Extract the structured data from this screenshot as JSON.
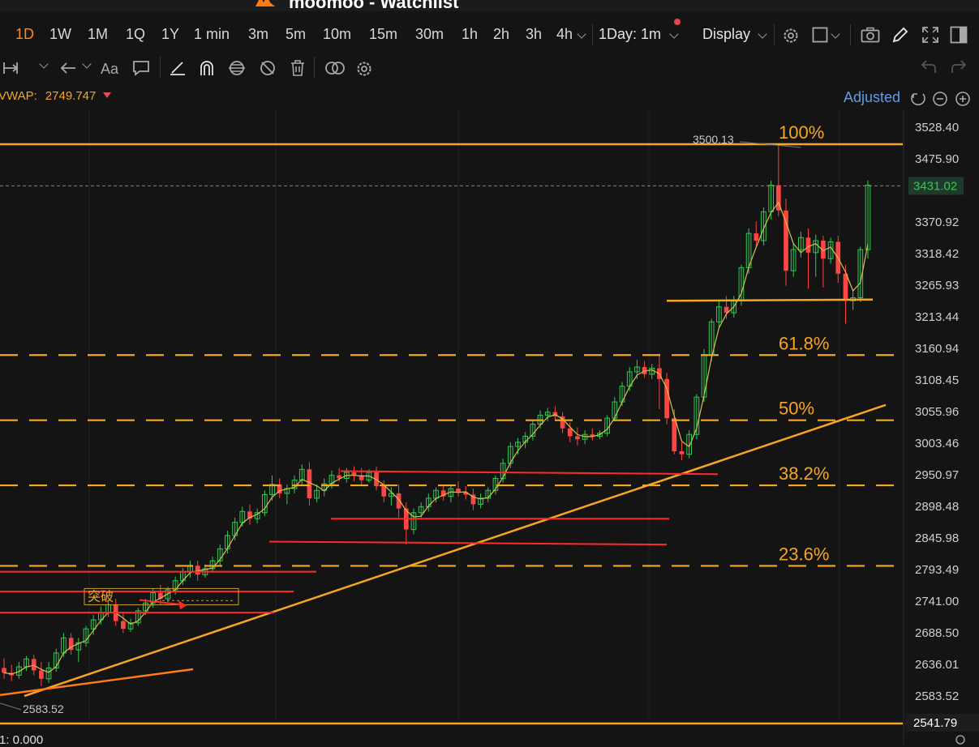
{
  "window": {
    "title": "moomoo - Watchlist"
  },
  "toolbar": {
    "timeframes": [
      "1D",
      "1W",
      "1M",
      "1Q",
      "1Y",
      "1 min",
      "3m",
      "5m",
      "10m",
      "15m",
      "30m",
      "1h",
      "2h",
      "3h",
      "4h"
    ],
    "active_timeframe": "1D",
    "interval_select": "1Day: 1m",
    "display_label": "Display"
  },
  "indicator": {
    "label": "VWAP:",
    "value": "2749.747"
  },
  "adjust_label": "Adjusted",
  "colors": {
    "up": "#2ecc52",
    "down": "#ff4444",
    "fib": "#f5a623",
    "support": "#ff2a2a",
    "background": "#141414",
    "current_price_bg": "#1f3a2a"
  },
  "chart_data": {
    "type": "candlestick",
    "ylim": [
      2541.79,
      3528.4
    ],
    "y_ticks": [
      "3528.40",
      "3475.90",
      "3431.02",
      "3370.92",
      "3318.42",
      "3265.93",
      "3213.44",
      "3160.94",
      "3108.45",
      "3055.96",
      "3003.46",
      "2950.97",
      "2898.48",
      "2845.98",
      "2793.49",
      "2741.00",
      "2688.50",
      "2636.01",
      "2583.52",
      "2541.79"
    ],
    "current_price": "3431.02",
    "high_label": "3500.13",
    "low_label": "2583.52",
    "fibonacci": [
      {
        "label": "100%",
        "value": 3500.13
      },
      {
        "label": "61.8%",
        "value": 3149.8
      },
      {
        "label": "50%",
        "value": 3041.6
      },
      {
        "label": "38.2%",
        "value": 2933.4
      },
      {
        "label": "23.6%",
        "value": 2799.6
      }
    ],
    "annotation": "突破",
    "bottom_readout": "1: 0.000",
    "candles": [
      {
        "o": 2630,
        "h": 2646,
        "l": 2612,
        "c": 2622
      },
      {
        "o": 2622,
        "h": 2635,
        "l": 2608,
        "c": 2618
      },
      {
        "o": 2618,
        "h": 2640,
        "l": 2612,
        "c": 2632
      },
      {
        "o": 2632,
        "h": 2650,
        "l": 2625,
        "c": 2645
      },
      {
        "o": 2645,
        "h": 2652,
        "l": 2618,
        "c": 2626
      },
      {
        "o": 2626,
        "h": 2640,
        "l": 2600,
        "c": 2612
      },
      {
        "o": 2612,
        "h": 2640,
        "l": 2605,
        "c": 2630
      },
      {
        "o": 2630,
        "h": 2662,
        "l": 2624,
        "c": 2655
      },
      {
        "o": 2655,
        "h": 2688,
        "l": 2648,
        "c": 2680
      },
      {
        "o": 2680,
        "h": 2688,
        "l": 2652,
        "c": 2660
      },
      {
        "o": 2660,
        "h": 2680,
        "l": 2640,
        "c": 2672
      },
      {
        "o": 2672,
        "h": 2700,
        "l": 2665,
        "c": 2695
      },
      {
        "o": 2695,
        "h": 2718,
        "l": 2685,
        "c": 2710
      },
      {
        "o": 2710,
        "h": 2732,
        "l": 2702,
        "c": 2722
      },
      {
        "o": 2722,
        "h": 2740,
        "l": 2715,
        "c": 2735
      },
      {
        "o": 2735,
        "h": 2745,
        "l": 2700,
        "c": 2708
      },
      {
        "o": 2708,
        "h": 2722,
        "l": 2688,
        "c": 2695
      },
      {
        "o": 2695,
        "h": 2712,
        "l": 2690,
        "c": 2705
      },
      {
        "o": 2705,
        "h": 2730,
        "l": 2700,
        "c": 2725
      },
      {
        "o": 2725,
        "h": 2745,
        "l": 2718,
        "c": 2738
      },
      {
        "o": 2738,
        "h": 2762,
        "l": 2730,
        "c": 2755
      },
      {
        "o": 2755,
        "h": 2768,
        "l": 2735,
        "c": 2745
      },
      {
        "o": 2745,
        "h": 2765,
        "l": 2740,
        "c": 2760
      },
      {
        "o": 2760,
        "h": 2782,
        "l": 2752,
        "c": 2775
      },
      {
        "o": 2775,
        "h": 2796,
        "l": 2768,
        "c": 2790
      },
      {
        "o": 2790,
        "h": 2808,
        "l": 2780,
        "c": 2800
      },
      {
        "o": 2800,
        "h": 2808,
        "l": 2775,
        "c": 2785
      },
      {
        "o": 2785,
        "h": 2802,
        "l": 2780,
        "c": 2795
      },
      {
        "o": 2795,
        "h": 2815,
        "l": 2790,
        "c": 2808
      },
      {
        "o": 2808,
        "h": 2835,
        "l": 2800,
        "c": 2828
      },
      {
        "o": 2828,
        "h": 2858,
        "l": 2820,
        "c": 2850
      },
      {
        "o": 2850,
        "h": 2880,
        "l": 2842,
        "c": 2872
      },
      {
        "o": 2872,
        "h": 2898,
        "l": 2865,
        "c": 2890
      },
      {
        "o": 2890,
        "h": 2902,
        "l": 2868,
        "c": 2878
      },
      {
        "o": 2878,
        "h": 2895,
        "l": 2870,
        "c": 2888
      },
      {
        "o": 2888,
        "h": 2925,
        "l": 2882,
        "c": 2918
      },
      {
        "o": 2918,
        "h": 2950,
        "l": 2908,
        "c": 2935
      },
      {
        "o": 2935,
        "h": 2945,
        "l": 2912,
        "c": 2920
      },
      {
        "o": 2920,
        "h": 2935,
        "l": 2902,
        "c": 2928
      },
      {
        "o": 2928,
        "h": 2950,
        "l": 2920,
        "c": 2942
      },
      {
        "o": 2942,
        "h": 2968,
        "l": 2935,
        "c": 2960
      },
      {
        "o": 2960,
        "h": 2972,
        "l": 2900,
        "c": 2912
      },
      {
        "o": 2912,
        "h": 2935,
        "l": 2905,
        "c": 2925
      },
      {
        "o": 2925,
        "h": 2945,
        "l": 2915,
        "c": 2936
      },
      {
        "o": 2936,
        "h": 2958,
        "l": 2928,
        "c": 2950
      },
      {
        "o": 2950,
        "h": 2962,
        "l": 2940,
        "c": 2945
      },
      {
        "o": 2945,
        "h": 2962,
        "l": 2938,
        "c": 2955
      },
      {
        "o": 2955,
        "h": 2965,
        "l": 2940,
        "c": 2950
      },
      {
        "o": 2950,
        "h": 2962,
        "l": 2935,
        "c": 2942
      },
      {
        "o": 2942,
        "h": 2960,
        "l": 2938,
        "c": 2955
      },
      {
        "o": 2955,
        "h": 2965,
        "l": 2925,
        "c": 2932
      },
      {
        "o": 2932,
        "h": 2942,
        "l": 2905,
        "c": 2915
      },
      {
        "o": 2915,
        "h": 2930,
        "l": 2900,
        "c": 2920
      },
      {
        "o": 2920,
        "h": 2935,
        "l": 2880,
        "c": 2895
      },
      {
        "o": 2895,
        "h": 2905,
        "l": 2835,
        "c": 2860
      },
      {
        "o": 2860,
        "h": 2895,
        "l": 2852,
        "c": 2888
      },
      {
        "o": 2888,
        "h": 2905,
        "l": 2880,
        "c": 2898
      },
      {
        "o": 2898,
        "h": 2920,
        "l": 2890,
        "c": 2912
      },
      {
        "o": 2912,
        "h": 2930,
        "l": 2905,
        "c": 2925
      },
      {
        "o": 2925,
        "h": 2935,
        "l": 2908,
        "c": 2915
      },
      {
        "o": 2915,
        "h": 2935,
        "l": 2905,
        "c": 2928
      },
      {
        "o": 2928,
        "h": 2940,
        "l": 2915,
        "c": 2922
      },
      {
        "o": 2922,
        "h": 2932,
        "l": 2910,
        "c": 2918
      },
      {
        "o": 2918,
        "h": 2928,
        "l": 2892,
        "c": 2902
      },
      {
        "o": 2902,
        "h": 2920,
        "l": 2895,
        "c": 2912
      },
      {
        "o": 2912,
        "h": 2930,
        "l": 2905,
        "c": 2925
      },
      {
        "o": 2925,
        "h": 2950,
        "l": 2918,
        "c": 2945
      },
      {
        "o": 2945,
        "h": 2978,
        "l": 2938,
        "c": 2970
      },
      {
        "o": 2970,
        "h": 3005,
        "l": 2962,
        "c": 2998
      },
      {
        "o": 2998,
        "h": 3012,
        "l": 2985,
        "c": 3005
      },
      {
        "o": 3005,
        "h": 3022,
        "l": 2995,
        "c": 3015
      },
      {
        "o": 3015,
        "h": 3042,
        "l": 3008,
        "c": 3035
      },
      {
        "o": 3035,
        "h": 3058,
        "l": 3028,
        "c": 3050
      },
      {
        "o": 3050,
        "h": 3062,
        "l": 3040,
        "c": 3055
      },
      {
        "o": 3055,
        "h": 3065,
        "l": 3042,
        "c": 3048
      },
      {
        "o": 3048,
        "h": 3055,
        "l": 3020,
        "c": 3028
      },
      {
        "o": 3028,
        "h": 3038,
        "l": 3005,
        "c": 3015
      },
      {
        "o": 3015,
        "h": 3030,
        "l": 3000,
        "c": 3010
      },
      {
        "o": 3010,
        "h": 3025,
        "l": 3002,
        "c": 3018
      },
      {
        "o": 3018,
        "h": 3028,
        "l": 3008,
        "c": 3015
      },
      {
        "o": 3015,
        "h": 3025,
        "l": 3010,
        "c": 3020
      },
      {
        "o": 3020,
        "h": 3050,
        "l": 3015,
        "c": 3045
      },
      {
        "o": 3045,
        "h": 3080,
        "l": 3040,
        "c": 3072
      },
      {
        "o": 3072,
        "h": 3105,
        "l": 3065,
        "c": 3098
      },
      {
        "o": 3098,
        "h": 3130,
        "l": 3090,
        "c": 3122
      },
      {
        "o": 3122,
        "h": 3142,
        "l": 3110,
        "c": 3130
      },
      {
        "o": 3130,
        "h": 3140,
        "l": 3112,
        "c": 3118
      },
      {
        "o": 3118,
        "h": 3135,
        "l": 3110,
        "c": 3128
      },
      {
        "o": 3128,
        "h": 3152,
        "l": 3060,
        "c": 3110
      },
      {
        "o": 3110,
        "h": 3120,
        "l": 3035,
        "c": 3045
      },
      {
        "o": 3045,
        "h": 3060,
        "l": 2985,
        "c": 2990
      },
      {
        "o": 2990,
        "h": 3005,
        "l": 2975,
        "c": 2985
      },
      {
        "o": 2985,
        "h": 3025,
        "l": 2978,
        "c": 3018
      },
      {
        "o": 3018,
        "h": 3085,
        "l": 3010,
        "c": 3080
      },
      {
        "o": 3080,
        "h": 3160,
        "l": 3072,
        "c": 3150
      },
      {
        "o": 3150,
        "h": 3210,
        "l": 3140,
        "c": 3205
      },
      {
        "o": 3205,
        "h": 3240,
        "l": 3195,
        "c": 3230
      },
      {
        "o": 3230,
        "h": 3248,
        "l": 3210,
        "c": 3220
      },
      {
        "o": 3220,
        "h": 3248,
        "l": 3212,
        "c": 3240
      },
      {
        "o": 3240,
        "h": 3300,
        "l": 3232,
        "c": 3295
      },
      {
        "o": 3295,
        "h": 3360,
        "l": 3285,
        "c": 3352
      },
      {
        "o": 3352,
        "h": 3372,
        "l": 3330,
        "c": 3340
      },
      {
        "o": 3340,
        "h": 3395,
        "l": 3332,
        "c": 3388
      },
      {
        "o": 3388,
        "h": 3440,
        "l": 3375,
        "c": 3432
      },
      {
        "o": 3432,
        "h": 3500,
        "l": 3380,
        "c": 3390
      },
      {
        "o": 3390,
        "h": 3410,
        "l": 3265,
        "c": 3290
      },
      {
        "o": 3290,
        "h": 3335,
        "l": 3280,
        "c": 3325
      },
      {
        "o": 3325,
        "h": 3355,
        "l": 3312,
        "c": 3345
      },
      {
        "o": 3345,
        "h": 3360,
        "l": 3260,
        "c": 3320
      },
      {
        "o": 3320,
        "h": 3350,
        "l": 3280,
        "c": 3340
      },
      {
        "o": 3340,
        "h": 3348,
        "l": 3262,
        "c": 3310
      },
      {
        "o": 3310,
        "h": 3345,
        "l": 3302,
        "c": 3338
      },
      {
        "o": 3338,
        "h": 3348,
        "l": 3270,
        "c": 3285
      },
      {
        "o": 3285,
        "h": 3300,
        "l": 3202,
        "c": 3240
      },
      {
        "o": 3240,
        "h": 3258,
        "l": 3225,
        "c": 3245
      },
      {
        "o": 3245,
        "h": 3330,
        "l": 3238,
        "c": 3325
      },
      {
        "o": 3325,
        "h": 3440,
        "l": 3310,
        "c": 3432
      }
    ]
  }
}
